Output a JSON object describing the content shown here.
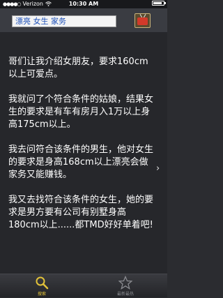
{
  "status_bar": {
    "carrier": "Verizon",
    "time": "10:30 AM"
  },
  "header": {
    "search_value": "漂亮 女生 家务",
    "tv_icon": "tv-icon"
  },
  "joke": {
    "text": "哥们让我介绍女朋友，要求160cm以上可爱点。\n\n我就问了个符合条件的姑娘，结果女生的要求是有车有房月入1万以上身高175cm以上。\n\n我去问符合该条件的男生，他对女生的要求是身高168cm以上漂亮会做家务又能赚钱。\n\n我又去找符合该条件的女生，她的要求是男方要有公司有别墅身高180cm以上......都TMD好好单着吧!"
  },
  "tab_bar": {
    "tabs": [
      {
        "label": "搜索",
        "icon": "search-icon",
        "color": "#e2c23a"
      },
      {
        "label": "最新最热",
        "icon": "star-icon",
        "color": "#8a8b90"
      }
    ]
  }
}
